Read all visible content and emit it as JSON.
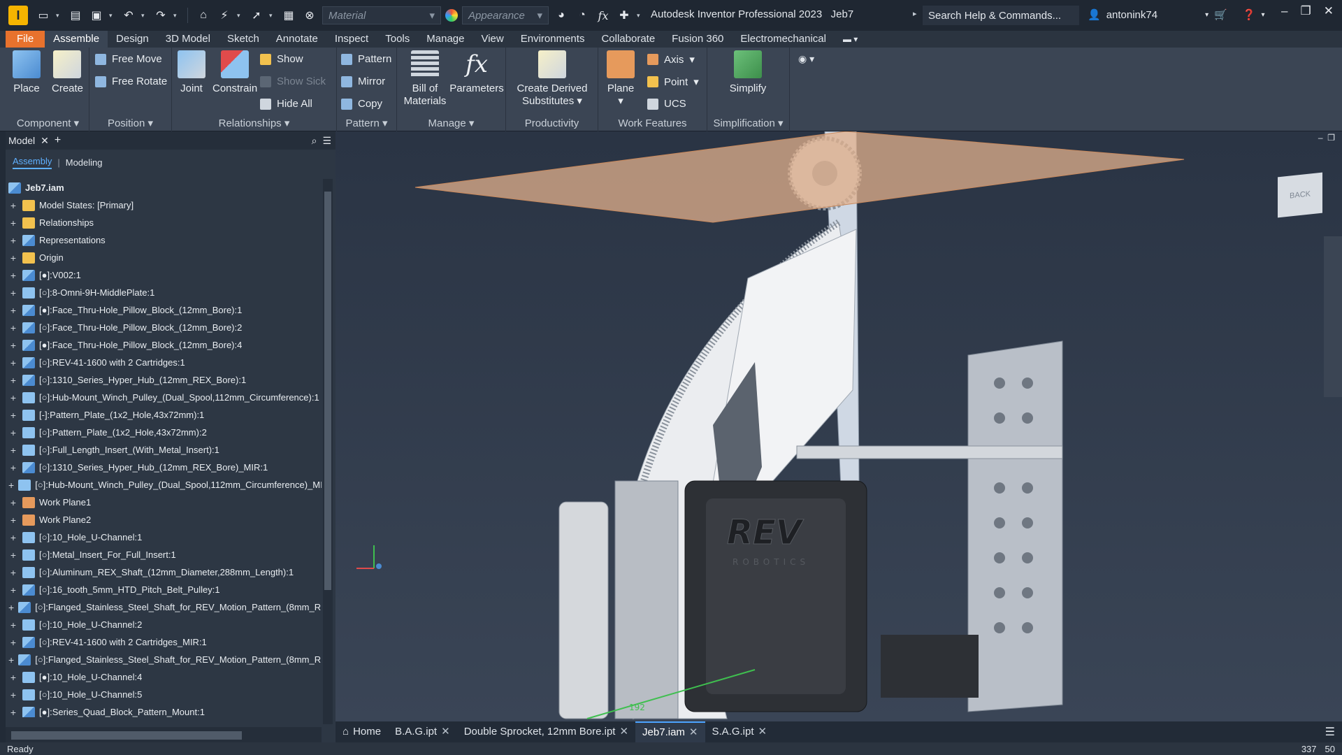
{
  "app": {
    "icon_letter": "I",
    "title": "Autodesk Inventor Professional 2023",
    "document": "Jeb7"
  },
  "quick_access": {
    "material_placeholder": "Material",
    "appearance_placeholder": "Appearance"
  },
  "search": {
    "placeholder": "Search Help & Commands..."
  },
  "user": {
    "name": "antonink74"
  },
  "ribbon_tabs": [
    "File",
    "Assemble",
    "Design",
    "3D Model",
    "Sketch",
    "Annotate",
    "Inspect",
    "Tools",
    "Manage",
    "View",
    "Environments",
    "Collaborate",
    "Fusion 360",
    "Electromechanical"
  ],
  "active_tab": "Assemble",
  "ribbon": {
    "component": {
      "title": "Component",
      "place": "Place",
      "create": "Create"
    },
    "position": {
      "title": "Position",
      "free_move": "Free Move",
      "free_rotate": "Free Rotate"
    },
    "relationships": {
      "title": "Relationships",
      "joint": "Joint",
      "constrain": "Constrain",
      "show": "Show",
      "show_sick": "Show Sick",
      "hide_all": "Hide All"
    },
    "pattern": {
      "title": "Pattern",
      "pattern": "Pattern",
      "mirror": "Mirror",
      "copy": "Copy"
    },
    "manage": {
      "title": "Manage",
      "bom_line1": "Bill of",
      "bom_line2": "Materials",
      "parameters": "Parameters"
    },
    "productivity": {
      "title": "Productivity",
      "derived_line1": "Create Derived",
      "derived_line2": "Substitutes"
    },
    "work_features": {
      "title": "Work Features",
      "plane": "Plane",
      "axis": "Axis",
      "point": "Point",
      "ucs": "UCS"
    },
    "simplification": {
      "title": "Simplification",
      "simplify": "Simplify"
    }
  },
  "browser": {
    "tab": "Model",
    "subtabs": {
      "assembly": "Assembly",
      "modeling": "Modeling"
    },
    "root": "Jeb7.iam",
    "items": [
      {
        "icon": "folder",
        "label": "Model States: [Primary]"
      },
      {
        "icon": "folder",
        "label": "Relationships"
      },
      {
        "icon": "asm",
        "label": "Representations"
      },
      {
        "icon": "orig",
        "label": "Origin"
      },
      {
        "icon": "asm",
        "label": "[●]:V002:1"
      },
      {
        "icon": "part",
        "label": "[○]:8-Omni-9H-MiddlePlate:1"
      },
      {
        "icon": "asm",
        "label": "[●]:Face_Thru-Hole_Pillow_Block_(12mm_Bore):1"
      },
      {
        "icon": "asm",
        "label": "[○]:Face_Thru-Hole_Pillow_Block_(12mm_Bore):2"
      },
      {
        "icon": "asm",
        "label": "[●]:Face_Thru-Hole_Pillow_Block_(12mm_Bore):4"
      },
      {
        "icon": "asm",
        "label": "[○]:REV-41-1600 with 2 Cartridges:1"
      },
      {
        "icon": "asm",
        "label": "[○]:1310_Series_Hyper_Hub_(12mm_REX_Bore):1"
      },
      {
        "icon": "part",
        "label": "[○]:Hub-Mount_Winch_Pulley_(Dual_Spool,112mm_Circumference):1"
      },
      {
        "icon": "part",
        "label": "[-]:Pattern_Plate_(1x2_Hole,43x72mm):1"
      },
      {
        "icon": "part",
        "label": "[○]:Pattern_Plate_(1x2_Hole,43x72mm):2"
      },
      {
        "icon": "part",
        "label": "[○]:Full_Length_Insert_(With_Metal_Insert):1"
      },
      {
        "icon": "asm",
        "label": "[○]:1310_Series_Hyper_Hub_(12mm_REX_Bore)_MIR:1"
      },
      {
        "icon": "part",
        "label": "[○]:Hub-Mount_Winch_Pulley_(Dual_Spool,112mm_Circumference)_MI"
      },
      {
        "icon": "plane",
        "label": "Work Plane1"
      },
      {
        "icon": "plane",
        "label": "Work Plane2"
      },
      {
        "icon": "part",
        "label": "[○]:10_Hole_U-Channel:1"
      },
      {
        "icon": "part",
        "label": "[○]:Metal_Insert_For_Full_Insert:1"
      },
      {
        "icon": "part",
        "label": "[○]:Aluminum_REX_Shaft_(12mm_Diameter,288mm_Length):1"
      },
      {
        "icon": "asm",
        "label": "[○]:16_tooth_5mm_HTD_Pitch_Belt_Pulley:1"
      },
      {
        "icon": "asm",
        "label": "[○]:Flanged_Stainless_Steel_Shaft_for_REV_Motion_Pattern_(8mm_RE"
      },
      {
        "icon": "part",
        "label": "[○]:10_Hole_U-Channel:2"
      },
      {
        "icon": "asm",
        "label": "[○]:REV-41-1600 with 2 Cartridges_MIR:1"
      },
      {
        "icon": "asm",
        "label": "[○]:Flanged_Stainless_Steel_Shaft_for_REV_Motion_Pattern_(8mm_RE"
      },
      {
        "icon": "part",
        "label": "[●]:10_Hole_U-Channel:4"
      },
      {
        "icon": "part",
        "label": "[○]:10_Hole_U-Channel:5"
      },
      {
        "icon": "asm",
        "label": "[●]:Series_Quad_Block_Pattern_Mount:1"
      }
    ]
  },
  "viewport": {
    "viewcube_face": "BACK",
    "dimension_label": "192",
    "logo_text": "REV",
    "logo_sub": "ROBOTICS"
  },
  "doc_tabs": [
    {
      "label": "Home",
      "closable": false
    },
    {
      "label": "B.A.G.ipt",
      "closable": true
    },
    {
      "label": "Double Sprocket, 12mm Bore.ipt",
      "closable": true
    },
    {
      "label": "Jeb7.iam",
      "closable": true,
      "active": true
    },
    {
      "label": "S.A.G.ipt",
      "closable": true
    }
  ],
  "status": {
    "text": "Ready",
    "count1": "337",
    "count2": "50"
  }
}
